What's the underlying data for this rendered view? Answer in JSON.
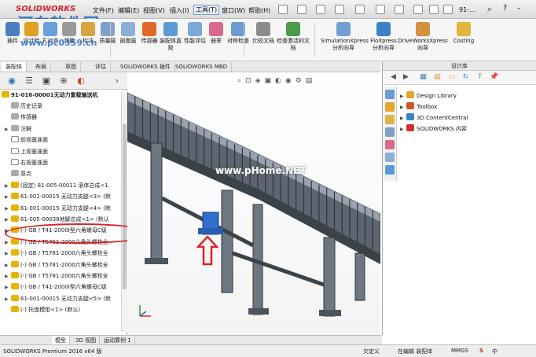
{
  "app": {
    "logo_text": "SOLIDWORKS",
    "watermark_cn": "河东软件园",
    "watermark_url": "www.pc0359.cn",
    "watermark_graphics": "www.pHome.NET"
  },
  "menu": {
    "file": "文件(F)",
    "edit": "编辑(E)",
    "view": "视图(V)",
    "insert": "插入(I)",
    "tools": "工具(T)",
    "window": "窗口(W)",
    "help": "帮助(H)",
    "search_text": "91-..."
  },
  "ribbon": {
    "buttons": [
      {
        "label": "插件",
        "icon": "plugin-icon",
        "color": "#4c7fc0"
      },
      {
        "label": "设计检",
        "icon": "design-check-icon",
        "color": "#e0a020"
      },
      {
        "label": "孔对齐",
        "icon": "hole-align-icon",
        "color": "#6aa0d8"
      },
      {
        "label": "测量",
        "icon": "measure-icon",
        "color": "#9a9a9a"
      },
      {
        "label": "标注",
        "icon": "markup-icon",
        "color": "#d9a441"
      },
      {
        "label": "质量属",
        "icon": "mass-props-icon",
        "color": "#7fa0c8"
      },
      {
        "label": "剖面属",
        "icon": "section-props-icon",
        "color": "#8ab0d8"
      },
      {
        "label": "传感器",
        "icon": "sensor-icon",
        "color": "#e06a2a"
      },
      {
        "label": "装配体直观",
        "icon": "assembly-visualization-icon",
        "color": "#5b9bd5"
      },
      {
        "label": "性能评估",
        "icon": "performance-icon",
        "color": "#7aa8d8"
      },
      {
        "label": "曲率",
        "icon": "curvature-icon",
        "color": "#d96a8e"
      },
      {
        "label": "对称检查",
        "icon": "symmetry-check-icon",
        "color": "#6c9bd2"
      },
      {
        "label": "比较文档",
        "icon": "compare-icon",
        "color": "#8b8b8b"
      },
      {
        "label": "检查激活的文档",
        "icon": "check-document-icon",
        "color": "#4c9a4c"
      },
      {
        "label": "SimulationXpress 分析向导",
        "icon": "simulation-icon",
        "color": "#6f9fd3"
      },
      {
        "label": "FloXpress 分析向导",
        "icon": "floxpress-icon",
        "color": "#3b83c9"
      },
      {
        "label": "DriveWorksXpress 向导",
        "icon": "driveworks-icon",
        "color": "#d4923c"
      },
      {
        "label": "Costing",
        "icon": "costing-icon",
        "color": "#e2b53b"
      }
    ]
  },
  "command_tabs": [
    "装配体",
    "布局",
    "草图",
    "评估",
    "SOLIDWORKS 插件",
    "SOLIDWORKS MBD"
  ],
  "feature_tree": {
    "root": "91-016-00001无动力重载输送机",
    "items": [
      {
        "label": "历史记录",
        "icon": "history-icon",
        "kind": "gray",
        "expand": ""
      },
      {
        "label": "传感器",
        "icon": "sensor-folder-icon",
        "kind": "gray",
        "expand": ""
      },
      {
        "label": "注解",
        "icon": "annotation-icon",
        "kind": "gray",
        "expand": "▶"
      },
      {
        "label": "前视基准面",
        "icon": "plane-icon",
        "kind": "plane",
        "expand": ""
      },
      {
        "label": "上视基准面",
        "icon": "plane-icon",
        "kind": "plane",
        "expand": ""
      },
      {
        "label": "右视基准面",
        "icon": "plane-icon",
        "kind": "plane",
        "expand": ""
      },
      {
        "label": "原点",
        "icon": "origin-icon",
        "kind": "gray",
        "expand": ""
      },
      {
        "label": "(固定) 81-005-00011 滚体总成<1",
        "icon": "assembly-icon",
        "kind": "yellow",
        "expand": "▶"
      },
      {
        "label": "61-001-00015 无动力支腿<3> (默",
        "icon": "assembly-icon",
        "kind": "yellow",
        "expand": "▶"
      },
      {
        "label": "61-001-00015 无动力支腿<4> (默",
        "icon": "assembly-icon",
        "kind": "yellow",
        "expand": "▶"
      },
      {
        "label": "61-005-00038地脚总成<1> (默认",
        "icon": "assembly-icon",
        "kind": "yellow",
        "expand": "▶"
      },
      {
        "label": "(-) GB / T41-2000I型六角螺母C级",
        "icon": "part-icon",
        "kind": "yellow",
        "expand": "▶"
      },
      {
        "label": "(-) GB / T5781-2000六角头螺栓全",
        "icon": "part-icon",
        "kind": "yellow",
        "expand": "▶"
      },
      {
        "label": "(-) GB / T5781-2000六角头螺栓全",
        "icon": "part-icon",
        "kind": "yellow",
        "expand": "▶"
      },
      {
        "label": "(-) GB / T5781-2000六角头螺栓全",
        "icon": "part-icon",
        "kind": "yellow",
        "expand": "▶"
      },
      {
        "label": "(-) GB / T5781-2000六角头螺栓全",
        "icon": "part-icon",
        "kind": "yellow",
        "expand": "▶"
      },
      {
        "label": "(-) GB / T41-2000I型六角螺母C级",
        "icon": "part-icon",
        "kind": "yellow",
        "expand": "▶"
      },
      {
        "label": "61-001-00015 无动力支腿<5> (默",
        "icon": "assembly-icon",
        "kind": "yellow",
        "expand": "▶"
      },
      {
        "label": "(-) 托盘模型<1> (默认)",
        "icon": "part-icon",
        "kind": "yellow",
        "expand": ""
      }
    ]
  },
  "design_library": {
    "title": "设计库",
    "items": [
      {
        "label": "Design Library",
        "icon": "design-library-icon",
        "color": "#e3a72f"
      },
      {
        "label": "Toolbox",
        "icon": "toolbox-icon",
        "color": "#c9552d"
      },
      {
        "label": "3D ContentCentral",
        "icon": "content-central-icon",
        "color": "#3d7fc4"
      },
      {
        "label": "SOLIDWORKS 内容",
        "icon": "solidworks-content-icon",
        "color": "#d32f2f"
      }
    ]
  },
  "bottom_tabs": [
    "模型",
    "3D 视图",
    "运动算例 1"
  ],
  "status": {
    "product": "SOLIDWORKS Premium 2016 x64 版",
    "defined": "欠定义",
    "editing": "在编辑 装配体",
    "units": "MMGS",
    "lang": "中"
  }
}
